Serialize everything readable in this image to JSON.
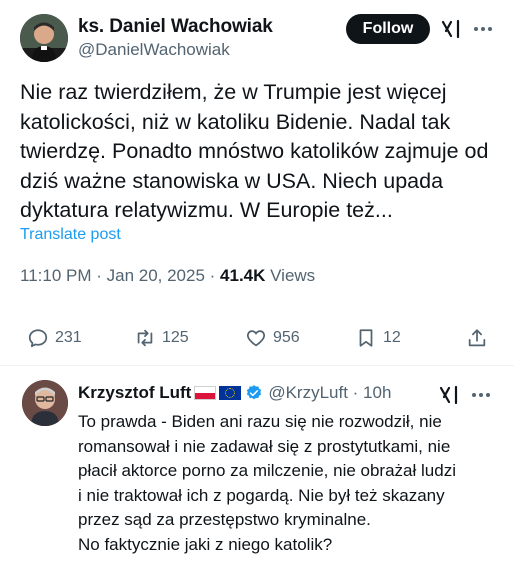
{
  "post": {
    "author_name": "ks. Daniel Wachowiak",
    "author_handle": "@DanielWachowiak",
    "follow_label": "Follow",
    "text_lines": [
      "Nie raz twierdziłem, że w Trumpie jest więcej",
      "katolickości, niż w katoliku Bidenie. Nadal tak",
      "twierdzę. Ponadto mnóstwo katolików zajmuje od",
      "dziś ważne stanowiska w USA. Niech upada",
      "dyktatura relatywizmu. W Europie też..."
    ],
    "translate_label": "Translate post",
    "timestamp": "11:10 PM · Jan 20, 2025 · ",
    "views_count": "41.4K",
    "views_label": " Views",
    "actions": {
      "replies": "231",
      "reposts": "125",
      "likes": "956",
      "bookmarks": "12"
    }
  },
  "reply": {
    "author_name": "Krzysztof Luft",
    "author_handle": "@KrzyLuft · 10h",
    "text_lines": [
      "To prawda - Biden ani razu się nie rozwodził, nie",
      "romansował i nie zadawał się z prostytutkami, nie",
      "płacił aktorce porno za milczenie, nie obrażał ludzi",
      "i nie traktował ich z pogardą. Nie był też skazany",
      "przez sąd za przestępstwo kryminalne.",
      "No faktycznie jaki z niego katolik?"
    ]
  },
  "icons": [
    "grok-icon",
    "more-icon",
    "reply-icon",
    "repost-icon",
    "like-icon",
    "bookmark-icon",
    "share-icon",
    "verified-icon",
    "flag-poland-icon",
    "flag-eu-icon"
  ],
  "colors": {
    "text": "#0f1419",
    "secondary": "#536471",
    "link": "#1d9bf0",
    "verified": "#1d9bf0",
    "follow_bg": "#0f1419"
  }
}
